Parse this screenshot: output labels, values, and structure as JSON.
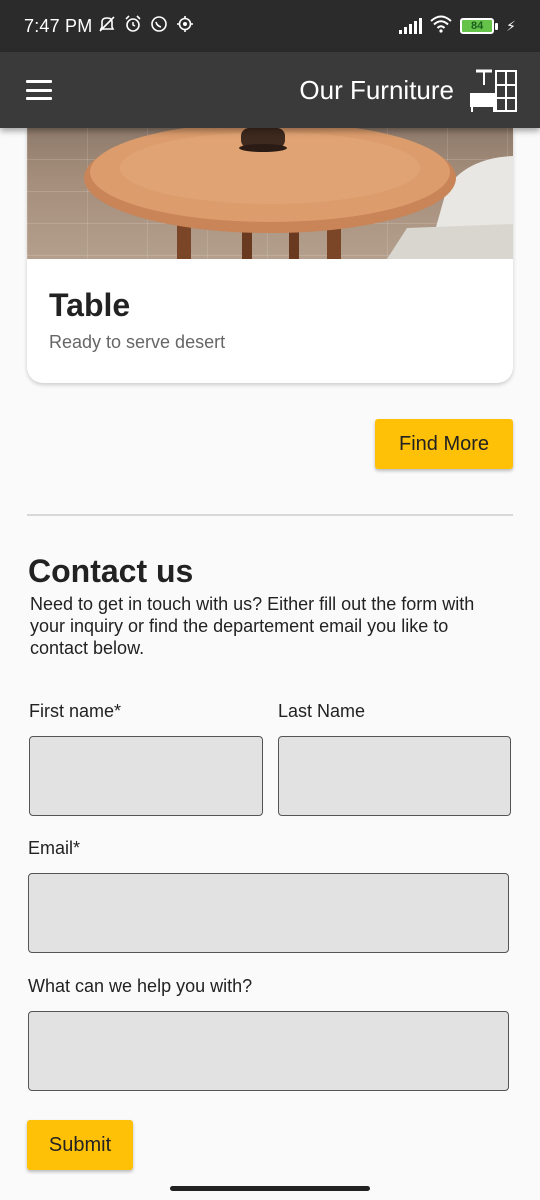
{
  "status_bar": {
    "time": "7:47 PM",
    "battery": "84",
    "icons_left": [
      "mute-icon",
      "alarm-icon",
      "whatsapp-icon",
      "settings-icon"
    ],
    "icons_right": [
      "signal-icon",
      "wifi-icon",
      "battery-icon",
      "charging-icon"
    ]
  },
  "app_bar": {
    "title": "Our Furniture",
    "menu_icon": "hamburger-menu-icon",
    "logo_icon": "furniture-logo-icon"
  },
  "card": {
    "title": "Table",
    "subtitle": "Ready to serve desert"
  },
  "find_more": {
    "label": "Find More"
  },
  "contact": {
    "title": "Contact us",
    "description": "Need to get in touch with us? Either fill out the form with your inquiry or find the departement email you like to contact below."
  },
  "form": {
    "first_name_label": "First name*",
    "last_name_label": "Last Name",
    "email_label": "Email*",
    "help_label": "What can we help you with?",
    "first_name_value": "",
    "last_name_value": "",
    "email_value": "",
    "help_value": "",
    "submit_label": "Submit"
  },
  "colors": {
    "accent": "#ffc107",
    "app_bar": "#3a3a3a",
    "status_bar": "#2b2b2b",
    "field_bg": "#e2e2e2"
  }
}
